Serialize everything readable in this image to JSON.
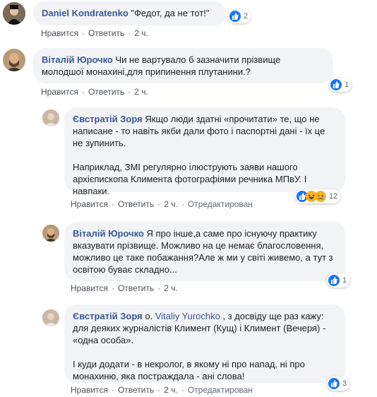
{
  "comments": [
    {
      "author": "Daniel Kondratenko",
      "paragraphs": [
        "\"Федот, да не тот!\""
      ],
      "like_label": "Нравится",
      "reply_label": "Ответить",
      "time": "2 ч.",
      "reaction_count": "2",
      "reactions": [
        "like-icon"
      ]
    },
    {
      "author": "Віталій Юрочко",
      "paragraphs": [
        "Чи не вартувало б зазначити прізвище молодшої монахині,для припинення плутанини.?"
      ],
      "like_label": "Нравится",
      "reply_label": "Ответить",
      "time": "2 ч.",
      "reaction_count": "1",
      "reactions": [
        "like-icon"
      ]
    },
    {
      "author": "Євстратій Зоря",
      "paragraphs": [
        "Якщо люди здатні «прочитати» те, що не написане - то навіть якби дали фото і паспортні дані - їх це не зупинить.",
        "Наприклад, ЗМІ регулярно ілюструють заяви нашого архієпископа Климента фотографіями речника МПвУ. І навпаки."
      ],
      "like_label": "Нравится",
      "reply_label": "Ответить",
      "time": "2 ч.",
      "edited_label": "Отредактирован",
      "reaction_count": "12",
      "reactions": [
        "like-icon",
        "haha-icon",
        "sad-icon"
      ]
    },
    {
      "author": "Віталій Юрочко",
      "paragraphs": [
        "Я про інше,а саме про існуючу практику вказувати прізвище. Можливо на це немає благословення, можливо це таке побажання?Але ж ми у світі живемо, а тут з освітою буває складно..."
      ],
      "like_label": "Нравится",
      "reply_label": "Ответить",
      "time": "2 ч.",
      "reaction_count": "1",
      "reactions": [
        "like-icon"
      ]
    },
    {
      "author": "Євстратій Зоря",
      "prefix": "о.",
      "mention": "Vitaliy Yurochko",
      "paragraphs": [
        ", з досвіду ще раз кажу: для деяких журналістів Климент (Кущ) і Климент (Вечеря) - «одна особа».",
        "І куди додати - в некролог, в якому ні про напад, ні про монахиню, яка постраждала - ані слова!"
      ],
      "like_label": "Нравится",
      "reply_label": "Ответить",
      "time": "2 ч.",
      "edited_label": "Отредактирован",
      "reaction_count": "3",
      "reactions": [
        "like-icon"
      ]
    }
  ],
  "colors": {
    "link": "#385898",
    "bubble": "#f2f3f5",
    "like": "#1877f2",
    "haha": "#f7b125"
  }
}
